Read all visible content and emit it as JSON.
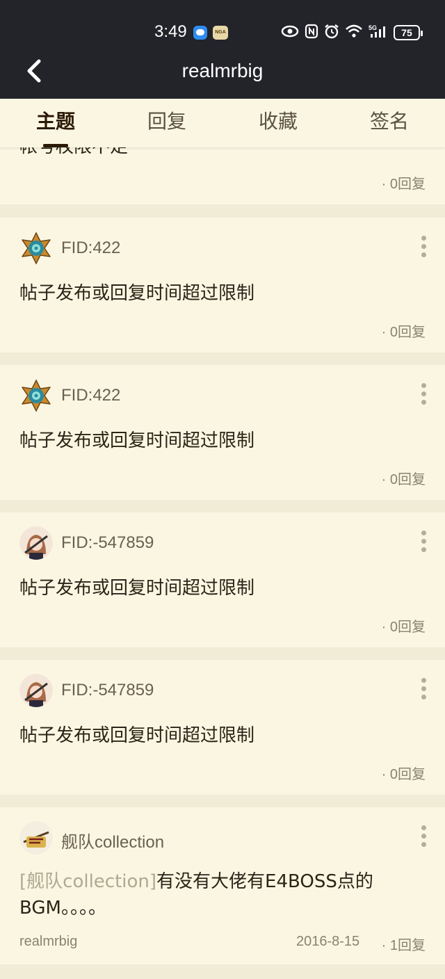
{
  "status_bar": {
    "time": "3:49",
    "battery": "75"
  },
  "header": {
    "title": "realmrbig"
  },
  "tabs": [
    {
      "label": "主题",
      "active": true
    },
    {
      "label": "回复",
      "active": false
    },
    {
      "label": "收藏",
      "active": false
    },
    {
      "label": "签名",
      "active": false
    }
  ],
  "posts": [
    {
      "author": "",
      "subject": "帐号权限不足",
      "replies": "· 0回复"
    },
    {
      "author": "FID:422",
      "subject": "帖子发布或回复时间超过限制",
      "replies": "· 0回复",
      "avatar": "hearthstone-icon"
    },
    {
      "author": "FID:422",
      "subject": "帖子发布或回复时间超过限制",
      "replies": "· 0回复",
      "avatar": "hearthstone-icon"
    },
    {
      "author": "FID:-547859",
      "subject": "帖子发布或回复时间超过限制",
      "replies": "· 0回复",
      "avatar": "anime-girl-avatar"
    },
    {
      "author": "FID:-547859",
      "subject": "帖子发布或回复时间超过限制",
      "replies": "· 0回复",
      "avatar": "anime-girl-avatar"
    },
    {
      "author": "舰队collection",
      "forum_tag": "[舰队collection]",
      "subject": "有没有大佬有E4BOSS点的BGM。。。。",
      "poster": "realmrbig",
      "date": "2016-8-15",
      "replies": "· 1回复",
      "avatar": "kancolle-icon"
    }
  ],
  "colors": {
    "header_bg": "#23232a",
    "card_bg": "#fbf6e2",
    "page_bg": "#f1ecd6",
    "text_dark": "#2a2418",
    "text_muted": "#8a826d"
  }
}
